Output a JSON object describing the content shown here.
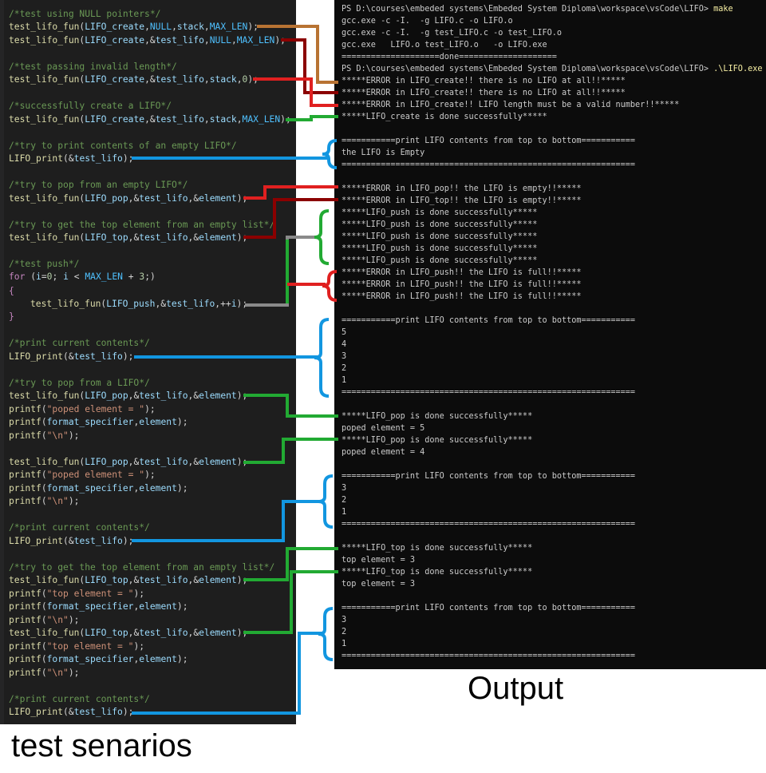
{
  "code": {
    "lines": [
      {
        "t": "/*test using NULL pointers*/",
        "k": "cmt"
      },
      {
        "t": "test_lifo_fun(LIFO_create,NULL,stack,MAX_LEN);",
        "k": "call"
      },
      {
        "t": "test_lifo_fun(LIFO_create,&test_lifo,NULL,MAX_LEN);",
        "k": "call"
      },
      {
        "t": "/*test passing invalid length*/",
        "k": "cmt"
      },
      {
        "t": "test_lifo_fun(LIFO_create,&test_lifo,stack,0);",
        "k": "call"
      },
      {
        "t": "/*successfully create a LIFO*/",
        "k": "cmt"
      },
      {
        "t": "test_lifo_fun(LIFO_create,&test_lifo,stack,MAX_LEN);",
        "k": "call"
      },
      {
        "t": "/*try to print contents of an empty LIFO*/",
        "k": "cmt"
      },
      {
        "t": "LIFO_print(&test_lifo);",
        "k": "call"
      },
      {
        "t": "/*try to pop from an empty LIFO*/",
        "k": "cmt"
      },
      {
        "t": "test_lifo_fun(LIFO_pop,&test_lifo,&element);",
        "k": "call"
      },
      {
        "t": "/*try to get the top element from an empty list*/",
        "k": "cmt"
      },
      {
        "t": "test_lifo_fun(LIFO_top,&test_lifo,&element);",
        "k": "call"
      },
      {
        "t": "/*test push*/",
        "k": "cmt"
      },
      {
        "t": "for (i=0; i < MAX_LEN + 3;)",
        "k": "for"
      },
      {
        "t": "{",
        "k": "brace"
      },
      {
        "t": "test_lifo_fun(LIFO_push,&test_lifo,++i);",
        "k": "call",
        "indent": true
      },
      {
        "t": "}",
        "k": "brace"
      },
      {
        "t": "/*print current contents*/",
        "k": "cmt"
      },
      {
        "t": "LIFO_print(&test_lifo);",
        "k": "call"
      },
      {
        "t": "/*try to pop from a LIFO*/",
        "k": "cmt"
      },
      {
        "t": "test_lifo_fun(LIFO_pop,&test_lifo,&element);",
        "k": "call"
      },
      {
        "t": "printf(\"poped element = \");",
        "k": "call"
      },
      {
        "t": "printf(format_specifier,element);",
        "k": "call"
      },
      {
        "t": "printf(\"\\n\");",
        "k": "call"
      },
      {
        "t": "test_lifo_fun(LIFO_pop,&test_lifo,&element);",
        "k": "call"
      },
      {
        "t": "printf(\"poped element = \");",
        "k": "call"
      },
      {
        "t": "printf(format_specifier,element);",
        "k": "call"
      },
      {
        "t": "printf(\"\\n\");",
        "k": "call"
      },
      {
        "t": "/*print current contents*/",
        "k": "cmt"
      },
      {
        "t": "LIFO_print(&test_lifo);",
        "k": "call"
      },
      {
        "t": "/*try to get the top element from an empty list*/",
        "k": "cmt"
      },
      {
        "t": "test_lifo_fun(LIFO_top,&test_lifo,&element);",
        "k": "call"
      },
      {
        "t": "printf(\"top element = \");",
        "k": "call"
      },
      {
        "t": "printf(format_specifier,element);",
        "k": "call"
      },
      {
        "t": "printf(\"\\n\");",
        "k": "call"
      },
      {
        "t": "test_lifo_fun(LIFO_top,&test_lifo,&element);",
        "k": "call"
      },
      {
        "t": "printf(\"top element = \");",
        "k": "call"
      },
      {
        "t": "printf(format_specifier,element);",
        "k": "call"
      },
      {
        "t": "printf(\"\\n\");",
        "k": "call"
      },
      {
        "t": "/*print current contents*/",
        "k": "cmt"
      },
      {
        "t": "LIFO_print(&test_lifo);",
        "k": "call"
      }
    ]
  },
  "terminal": {
    "lines": [
      {
        "p": "PS D:\\courses\\embeded systems\\Embeded System Diploma\\workspace\\vsCode\\LIFO> ",
        "c": "make"
      },
      {
        "p": "gcc.exe -c -I.  -g LIFO.c -o LIFO.o"
      },
      {
        "p": "gcc.exe -c -I.  -g test_LIFO.c -o test_LIFO.o"
      },
      {
        "p": "gcc.exe   LIFO.o test_LIFO.o   -o LIFO.exe"
      },
      {
        "p": "====================done===================="
      },
      {
        "p": "PS D:\\courses\\embeded systems\\Embeded System Diploma\\workspace\\vsCode\\LIFO> ",
        "c": ".\\LIFO.exe"
      },
      {
        "p": "*****ERROR in LIFO_create!! there is no LIFO at all!!*****"
      },
      {
        "p": "*****ERROR in LIFO_create!! there is no LIFO at all!!*****"
      },
      {
        "p": "*****ERROR in LIFO_create!! LIFO length must be a valid number!!*****"
      },
      {
        "p": "*****LIFO_create is done successfully*****"
      },
      {
        "p": ""
      },
      {
        "p": "===========print LIFO contents from top to bottom==========="
      },
      {
        "p": "the LIFO is Empty"
      },
      {
        "p": "============================================================"
      },
      {
        "p": ""
      },
      {
        "p": "*****ERROR in LIFO_pop!! the LIFO is empty!!*****"
      },
      {
        "p": "*****ERROR in LIFO_top!! the LIFO is empty!!*****"
      },
      {
        "p": "*****LIFO_push is done successfully*****"
      },
      {
        "p": "*****LIFO_push is done successfully*****"
      },
      {
        "p": "*****LIFO_push is done successfully*****"
      },
      {
        "p": "*****LIFO_push is done successfully*****"
      },
      {
        "p": "*****LIFO_push is done successfully*****"
      },
      {
        "p": "*****ERROR in LIFO_push!! the LIFO is full!!*****"
      },
      {
        "p": "*****ERROR in LIFO_push!! the LIFO is full!!*****"
      },
      {
        "p": "*****ERROR in LIFO_push!! the LIFO is full!!*****"
      },
      {
        "p": ""
      },
      {
        "p": "===========print LIFO contents from top to bottom==========="
      },
      {
        "p": "5"
      },
      {
        "p": "4"
      },
      {
        "p": "3"
      },
      {
        "p": "2"
      },
      {
        "p": "1"
      },
      {
        "p": "============================================================"
      },
      {
        "p": ""
      },
      {
        "p": "*****LIFO_pop is done successfully*****"
      },
      {
        "p": "poped element = 5"
      },
      {
        "p": "*****LIFO_pop is done successfully*****"
      },
      {
        "p": "poped element = 4"
      },
      {
        "p": ""
      },
      {
        "p": "===========print LIFO contents from top to bottom==========="
      },
      {
        "p": "3"
      },
      {
        "p": "2"
      },
      {
        "p": "1"
      },
      {
        "p": "============================================================"
      },
      {
        "p": ""
      },
      {
        "p": "*****LIFO_top is done successfully*****"
      },
      {
        "p": "top element = 3"
      },
      {
        "p": "*****LIFO_top is done successfully*****"
      },
      {
        "p": "top element = 3"
      },
      {
        "p": ""
      },
      {
        "p": "===========print LIFO contents from top to bottom==========="
      },
      {
        "p": "3"
      },
      {
        "p": "2"
      },
      {
        "p": "1"
      },
      {
        "p": "============================================================"
      }
    ]
  },
  "captions": {
    "output": "Output",
    "tests": "test senarios"
  },
  "colors": {
    "code_bg": "#1e1e1e",
    "terminal_bg": "#0c0c0c",
    "wire_brown": "#b87333",
    "wire_darkred": "#8b0000",
    "wire_red": "#e02020",
    "wire_green": "#22aa33",
    "wire_blue": "#1296e0",
    "wire_gray": "#8a8a8a"
  }
}
